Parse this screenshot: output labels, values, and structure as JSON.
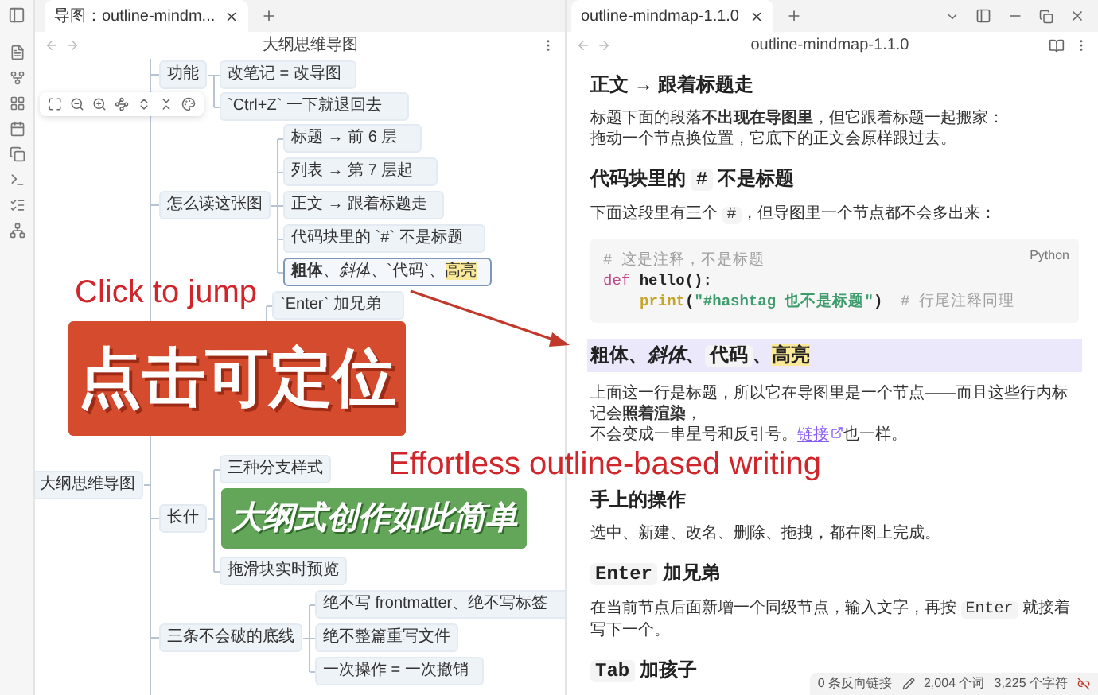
{
  "left_tabs": [
    {
      "label": "导图：outline-mindm...",
      "selected": true
    }
  ],
  "left_pane": {
    "title": "大纲思维导图"
  },
  "mindmap": {
    "root": {
      "text": "大纲思维导图",
      "selected": false,
      "children": [
        {
          "text": "功能",
          "selected": false,
          "children": [
            {
              "text": "改笔记 = 改导图",
              "selected": false
            },
            {
              "text": "`Ctrl+Z` 一下就退回去",
              "selected": false
            }
          ]
        },
        {
          "text": "怎么读这张图",
          "selected": false,
          "children": [
            {
              "text": "标题 → 前 6 层",
              "selected": false
            },
            {
              "text": "列表 → 第 7 层起",
              "selected": false
            },
            {
              "text": "正文 → 跟着标题走",
              "selected": false
            },
            {
              "text": "代码块里的 `#` 不是标题",
              "selected": false
            },
            {
              "parts": [
                {
                  "kind": "bold",
                  "text": "粗体"
                },
                {
                  "kind": "plain",
                  "text": "、"
                },
                {
                  "kind": "italic",
                  "text": "斜体"
                },
                {
                  "kind": "plain",
                  "text": "、`代码`、"
                },
                {
                  "kind": "mark",
                  "text": "高亮"
                }
              ],
              "selected": true
            }
          ]
        },
        {
          "children": [
            {
              "text": "`Enter` 加兄弟",
              "selected": false
            }
          ]
        },
        {
          "text": "长什",
          "selected": false,
          "children": [
            {
              "text": "三种分支样式",
              "selected": false
            },
            {
              "text": "拖滑块实时预览",
              "selected": false
            }
          ]
        },
        {
          "text": "三条不会破的底线",
          "selected": false,
          "children": [
            {
              "text": "绝不写 frontmatter、绝不写标签",
              "selected": false
            },
            {
              "text": "绝不整篇重写文件",
              "selected": false
            },
            {
              "text": "一次操作 = 一次撤销",
              "selected": false
            }
          ]
        }
      ]
    }
  },
  "right_tabs": [
    {
      "label": "outline-mindmap-1.1.0",
      "selected": true
    }
  ],
  "right_pane": {
    "title": "outline-mindmap-1.1.0"
  },
  "document": [
    {
      "kind": "heading",
      "highlighted": false,
      "parts": [
        {
          "kind": "plain",
          "text": "正文 → 跟着标题走"
        }
      ]
    },
    {
      "kind": "paragraph",
      "lines": [
        [
          {
            "kind": "plain",
            "text": "标题下面的段落"
          },
          {
            "kind": "bold",
            "text": "不出现在导图里"
          },
          {
            "kind": "plain",
            "text": "，但它跟着标题一起搬家："
          }
        ],
        [
          {
            "kind": "plain",
            "text": "拖动一个节点换位置，它底下的正文会原样跟过去。"
          }
        ]
      ]
    },
    {
      "kind": "heading",
      "highlighted": false,
      "parts": [
        {
          "kind": "plain",
          "text": "代码块里的 "
        },
        {
          "kind": "code",
          "text": "#"
        },
        {
          "kind": "plain",
          "text": " 不是标题"
        }
      ]
    },
    {
      "kind": "paragraph",
      "lines": [
        [
          {
            "kind": "plain",
            "text": "下面这段里有三个 "
          },
          {
            "kind": "code",
            "text": "#"
          },
          {
            "kind": "plain",
            "text": "，但导图里一个节点都不会多出来："
          }
        ]
      ]
    },
    {
      "kind": "code",
      "language": "Python",
      "lines": [
        [
          {
            "kind": "comment",
            "text": "# 这是注释，不是标题"
          }
        ],
        [
          {
            "kind": "keyword",
            "text": "def "
          },
          {
            "kind": "name",
            "text": "hello():"
          }
        ],
        [
          {
            "kind": "func",
            "text": "print"
          },
          {
            "kind": "name",
            "text": "("
          },
          {
            "kind": "string",
            "text": "\"#hashtag 也不是标题\""
          },
          {
            "kind": "name",
            "text": ")"
          },
          {
            "kind": "comment",
            "text": "  # 行尾注释同理"
          }
        ]
      ]
    },
    {
      "kind": "heading",
      "highlighted": true,
      "parts": [
        {
          "kind": "bold",
          "text": "粗体"
        },
        {
          "kind": "plain",
          "text": "、"
        },
        {
          "kind": "italic",
          "text": "斜体"
        },
        {
          "kind": "plain",
          "text": "、"
        },
        {
          "kind": "code",
          "text": "代码"
        },
        {
          "kind": "plain",
          "text": "、"
        },
        {
          "kind": "mark",
          "text": "高亮"
        }
      ]
    },
    {
      "kind": "paragraph",
      "lines": [
        [
          {
            "kind": "plain",
            "text": "上面这一行是标题，所以它在导图里是一个节点——而且这些行内标记会"
          },
          {
            "kind": "bold",
            "text": "照着渲染"
          },
          {
            "kind": "plain",
            "text": "，"
          }
        ],
        [
          {
            "kind": "plain",
            "text": "不会变成一串星号和反引号。"
          },
          {
            "kind": "link",
            "text": "链接"
          },
          {
            "kind": "plain",
            "text": "也一样。"
          }
        ]
      ]
    },
    {
      "kind": "heading",
      "highlighted": false,
      "parts": [
        {
          "kind": "plain",
          "text": "手上的操作"
        }
      ]
    },
    {
      "kind": "paragraph",
      "lines": [
        [
          {
            "kind": "plain",
            "text": "选中、新建、改名、删除、拖拽，都在图上完成。"
          }
        ]
      ]
    },
    {
      "kind": "heading",
      "highlighted": false,
      "parts": [
        {
          "kind": "code",
          "text": "Enter"
        },
        {
          "kind": "plain",
          "text": " 加兄弟"
        }
      ]
    },
    {
      "kind": "paragraph",
      "lines": [
        [
          {
            "kind": "plain",
            "text": "在当前节点后面新增一个同级节点，输入文字，再按 "
          },
          {
            "kind": "code",
            "text": "Enter"
          },
          {
            "kind": "plain",
            "text": " 就接着写下一个。"
          }
        ]
      ]
    },
    {
      "kind": "heading",
      "highlighted": false,
      "parts": [
        {
          "kind": "code",
          "text": "Tab"
        },
        {
          "kind": "plain",
          "text": " 加孩子"
        }
      ]
    }
  ],
  "status_bar": {
    "backlinks": "0 条反向链接",
    "words": "2,004 个词",
    "characters": "3,225 个字符"
  },
  "annotations": [
    {
      "kind": "caption",
      "text": "Click to jump"
    },
    {
      "kind": "banner",
      "text": "点击可定位",
      "color": "#d54b2d"
    },
    {
      "kind": "arrow"
    },
    {
      "kind": "caption",
      "text": "Effortless outline-based writing"
    },
    {
      "kind": "banner",
      "text": "大纲式创作如此简单",
      "color": "#63a65a"
    }
  ]
}
